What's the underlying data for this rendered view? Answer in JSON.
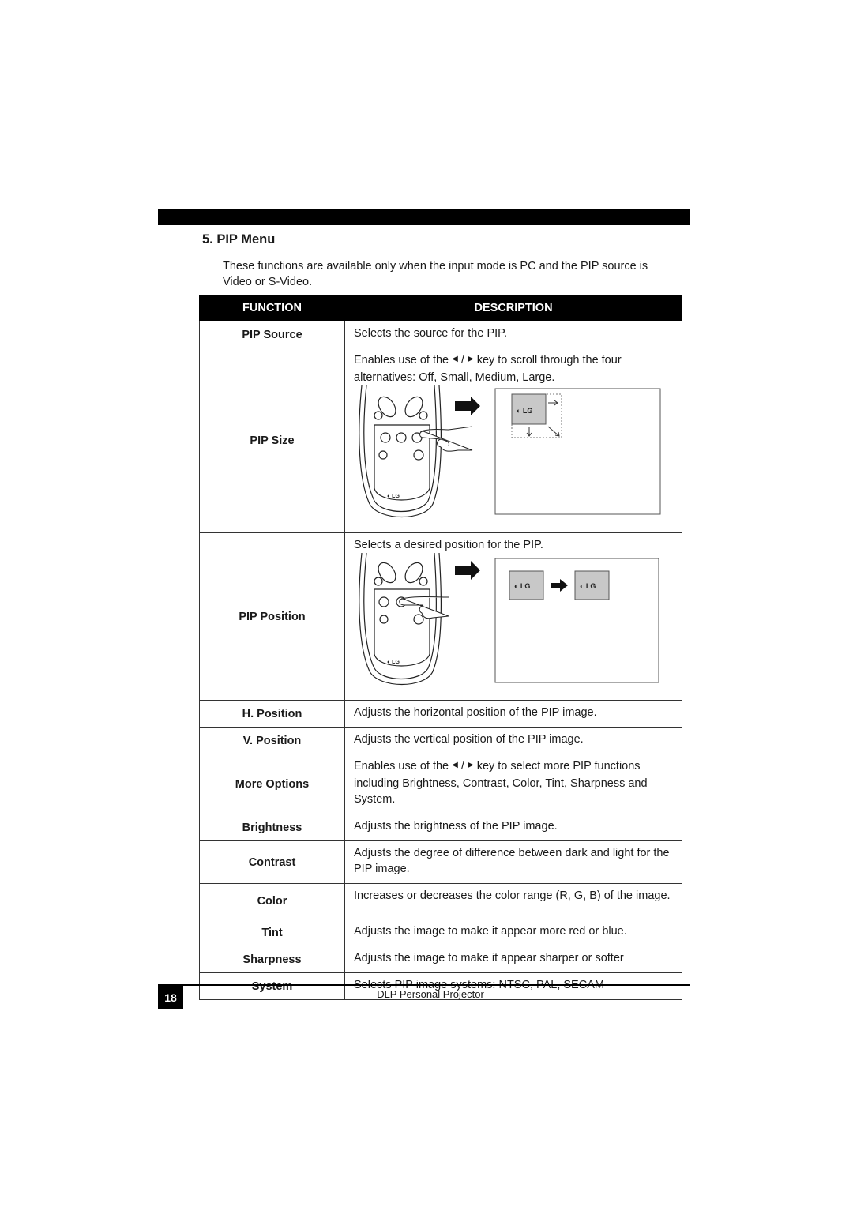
{
  "section": {
    "title": "5. PIP Menu",
    "intro": "These functions are available only when the input mode is PC and the PIP source is Video or S-Video."
  },
  "table": {
    "headers": {
      "function": "FUNCTION",
      "description": "DESCRIPTION"
    },
    "rows": [
      {
        "function": "PIP Source",
        "description": "Selects the source for the PIP."
      },
      {
        "function": "PIP Size",
        "description_pre": "Enables use of the",
        "description_post": "key to scroll through the four alternatives: Off, Small, Medium, Large.",
        "illustration": "remote-pip-size-button-and-pip-window-resizing"
      },
      {
        "function": "PIP Position",
        "description": "Selects a desired position for the PIP.",
        "illustration": "remote-pip-position-button-and-pip-window-moving"
      },
      {
        "function": "H. Position",
        "description": "Adjusts the horizontal position of the PIP image."
      },
      {
        "function": "V. Position",
        "description": "Adjusts the vertical position of the PIP image."
      },
      {
        "function": "More Options",
        "description_pre": "Enables use of the",
        "description_post": "key to select more PIP functions including Brightness, Contrast, Color, Tint, Sharpness and System."
      },
      {
        "function": "Brightness",
        "description": "Adjusts the brightness of the PIP image."
      },
      {
        "function": "Contrast",
        "description": "Adjusts the degree of difference between dark and light for the PIP image."
      },
      {
        "function": "Color",
        "description": "Increases or decreases the color range (R, G, B) of the image."
      },
      {
        "function": "Tint",
        "description": "Adjusts the image to make it appear more red or blue."
      },
      {
        "function": "Sharpness",
        "description": "Adjusts the image to make it appear sharper or softer"
      },
      {
        "function": "System",
        "description": "Selects PIP image systems: NTSC, PAL, SECAM"
      }
    ],
    "key_glyphs": {
      "left": "◀",
      "sep": "/",
      "right": "▶"
    },
    "logo_text": "LG"
  },
  "footer": {
    "page_number": "18",
    "title": "DLP Personal Projector"
  }
}
